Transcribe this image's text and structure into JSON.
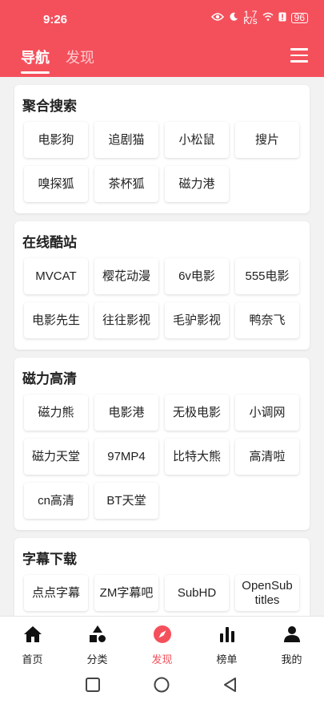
{
  "status": {
    "time": "9:26",
    "net_speed": "1.7",
    "net_unit": "K/s",
    "battery": "96"
  },
  "header": {
    "tabs": [
      {
        "label": "导航"
      },
      {
        "label": "发现"
      }
    ],
    "active_tab": 0
  },
  "sections": [
    {
      "title": "聚合搜索",
      "items": [
        "电影狗",
        "追剧猫",
        "小松鼠",
        "搜片",
        "嗅探狐",
        "茶杯狐",
        "磁力港"
      ]
    },
    {
      "title": "在线酷站",
      "items": [
        "MVCAT",
        "樱花动漫",
        "6v电影",
        "555电影",
        "电影先生",
        "往往影视",
        "毛驴影视",
        "鸭奈飞"
      ]
    },
    {
      "title": "磁力高清",
      "items": [
        "磁力熊",
        "电影港",
        "无极电影",
        "小调网",
        "磁力天堂",
        "97MP4",
        "比特大熊",
        "高清啦",
        "cn高清",
        "BT天堂"
      ]
    },
    {
      "title": "字幕下载",
      "items": [
        "点点字幕",
        "ZM字幕吧",
        "SubHD",
        "OpenSub titles"
      ]
    }
  ],
  "bottom_nav": [
    {
      "label": "首页",
      "icon": "home-icon"
    },
    {
      "label": "分类",
      "icon": "category-icon"
    },
    {
      "label": "发现",
      "icon": "compass-icon"
    },
    {
      "label": "榜单",
      "icon": "chart-icon"
    },
    {
      "label": "我的",
      "icon": "user-icon"
    }
  ],
  "bottom_nav_active": 2,
  "colors": {
    "accent": "#f4505c",
    "background": "#f2f2f2",
    "card": "#ffffff"
  }
}
